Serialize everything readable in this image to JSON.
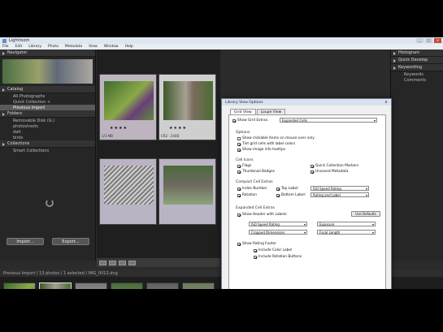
{
  "window": {
    "title": "Lightroom",
    "buttons": {
      "min": "_",
      "max": "□",
      "close": "x"
    }
  },
  "menu": [
    "File",
    "Edit",
    "Library",
    "Photo",
    "Metadata",
    "View",
    "Window",
    "Help"
  ],
  "left_panel": {
    "navigator": "Navigator",
    "catalog": "Catalog",
    "catalog_items": [
      "All Photographs",
      "Quick Collection +",
      "Previous Import"
    ],
    "folders": "Folders",
    "folder_volume": "Removable Disk (G:)",
    "folder_items": [
      "photoshoots",
      "dalt",
      "birds"
    ],
    "collections": "Collections",
    "collection_item": "Smart Collections",
    "import_btn": "Import...",
    "export_btn": "Export..."
  },
  "grid": {
    "cells": [
      {
        "meta": "1/3 MB",
        "stars": "★★★★"
      },
      {
        "meta": "CR2 · 2048",
        "stars": "★★★★"
      },
      {
        "meta": "",
        "stars": ""
      },
      {
        "meta": "",
        "stars": ""
      }
    ]
  },
  "right_panel": {
    "histogram": "Histogram",
    "quick_develop": "Quick Develop",
    "keywording": "Keywording",
    "keywords": "Keywords",
    "comments": "Comments"
  },
  "filmstrip_bar": {
    "label": "Previous Import / 13 photos / 1 selected / IMG_0012.dng"
  },
  "dialog": {
    "title": "Library View Options",
    "close": "x",
    "tabs": [
      "Grid View",
      "Loupe View"
    ],
    "show_grid_extras": "Show Grid Extras:",
    "grid_extras_value": "Expanded Cells",
    "options_title": "Options",
    "options": [
      "Show clickable items on mouse over only",
      "Tint grid cells with label colors",
      "Show image info tooltips"
    ],
    "cell_icons_title": "Cell Icons",
    "cell_icons": [
      "Flags",
      "Quick Collection Markers",
      "Thumbnail Badges",
      "Unsaved Metadata"
    ],
    "compact_title": "Compact Cell Extras",
    "compact": [
      "Index Number",
      "Top Label:",
      "Rotation",
      "Bottom Label:"
    ],
    "compact_values": [
      "ISO Speed Rating",
      "Rating and Label"
    ],
    "expanded_title": "Expanded Cell Extras",
    "show_header": "Show Header with Labels:",
    "use_defaults": "Use Defaults",
    "header_values": [
      "ISO Speed Rating",
      "Cropped Dimensions",
      "Exposure",
      "Focal Length"
    ],
    "show_rating_footer": "Show Rating Footer",
    "footer_options": [
      "Include Color Label",
      "Include Rotation Buttons"
    ]
  }
}
